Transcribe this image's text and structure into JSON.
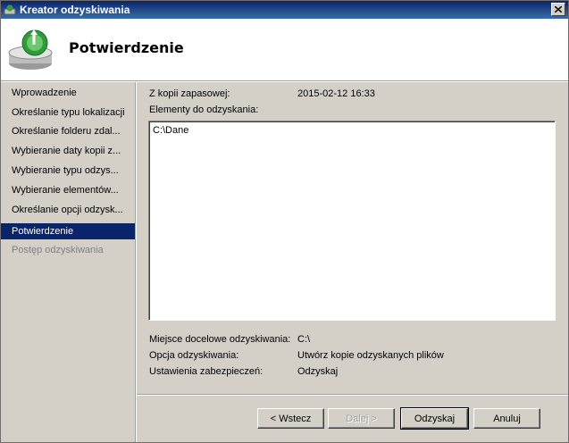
{
  "window": {
    "title": "Kreator odzyskiwania"
  },
  "header": {
    "title": "Potwierdzenie"
  },
  "steps": [
    {
      "label": "Wprowadzenie"
    },
    {
      "label": "Określanie typu lokalizacji"
    },
    {
      "label": "Określanie folderu zdal..."
    },
    {
      "label": "Wybieranie daty kopii z..."
    },
    {
      "label": "Wybieranie typu odzys..."
    },
    {
      "label": "Wybieranie elementów..."
    },
    {
      "label": "Określanie opcji odzysk..."
    },
    {
      "label": "Potwierdzenie"
    },
    {
      "label": "Postęp odzyskiwania"
    }
  ],
  "summary": {
    "backup_label": "Z kopii zapasowej:",
    "backup_value": "2015-02-12 16:33",
    "items_label": "Elementy do odzyskania:",
    "items": [
      "C:\\Dane"
    ],
    "destination_label": "Miejsce docelowe odzyskiwania:",
    "destination_value": "C:\\",
    "option_label": "Opcja odzyskiwania:",
    "option_value": "Utwórz kopie odzyskanych plików",
    "security_label": "Ustawienia zabezpieczeń:",
    "security_value": "Odzyskaj"
  },
  "buttons": {
    "back": "< Wstecz",
    "next": "Dalej >",
    "recover": "Odzyskaj",
    "cancel": "Anuluj"
  }
}
